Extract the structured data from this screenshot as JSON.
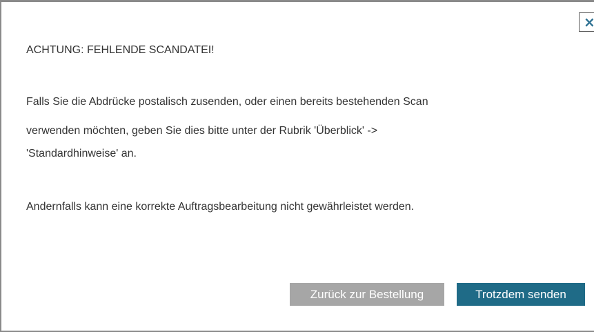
{
  "dialog": {
    "close_icon": "×",
    "title": "ACHTUNG: FEHLENDE SCANDATEI!",
    "body_lines": [
      "Falls Sie die Abdrücke postalisch zusenden, oder einen bereits bestehenden Scan",
      "verwenden möchten, geben Sie dies bitte unter der Rubrik 'Überblick' ->",
      "'Standardhinweise' an."
    ],
    "warning": "Andernfalls kann eine korrekte Auftragsbearbeitung nicht gewährleistet werden.",
    "buttons": {
      "back_label": "Zurück zur Bestellung",
      "send_label": "Trotzdem senden"
    }
  },
  "colors": {
    "text": "#333333",
    "back_button": "#a6a6a6",
    "send_button": "#1f6b87",
    "close_icon": "#2a6f91",
    "border": "#8a8a8a"
  }
}
